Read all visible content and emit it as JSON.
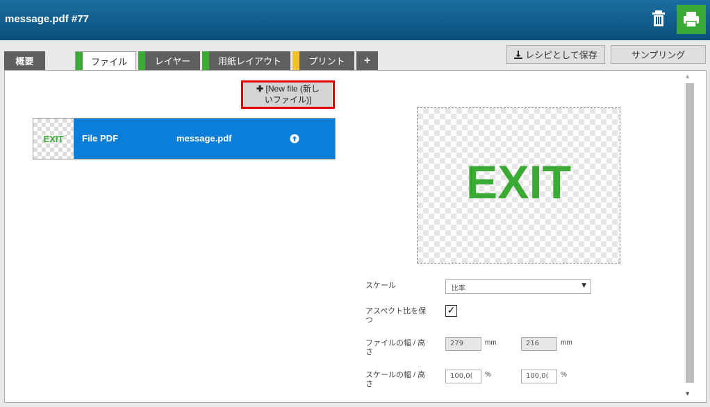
{
  "header": {
    "title": "message.pdf #77"
  },
  "tabs": [
    {
      "label": "概要",
      "stripe_color": ""
    },
    {
      "label": "ファイル",
      "stripe_color": "#3aaa35"
    },
    {
      "label": "レイヤー",
      "stripe_color": "#3aaa35"
    },
    {
      "label": "用紙レイアウト",
      "stripe_color": "#3aaa35"
    },
    {
      "label": "プリント",
      "stripe_color": "#f2c12e"
    },
    {
      "label": "+",
      "stripe_color": ""
    }
  ],
  "toolbar": {
    "save_recipe_label": "レシピとして保存",
    "sampling_label": "サンプリング"
  },
  "new_file": {
    "line1": "[New file (新し",
    "line2": "いファイル)]"
  },
  "file": {
    "thumb_text": "EXIT",
    "type": "File PDF",
    "name": "message.pdf"
  },
  "preview": {
    "text": "EXIT"
  },
  "form": {
    "scale_label": "スケール",
    "scale_value": "比率",
    "aspect_label": "アスペクト比を保つ",
    "aspect_checked": true,
    "file_size_label": "ファイルの幅 / 高さ",
    "file_width": "279",
    "file_height": "216",
    "file_unit": "mm",
    "scale_size_label": "スケールの幅 / 高さ",
    "scale_width": "100,0(",
    "scale_height": "100,0(",
    "scale_unit": "%"
  },
  "colors": {
    "header": "#0a4f7c",
    "accent_green": "#3aaa35",
    "file_row_blue": "#0a7ed9",
    "highlight_red": "#e00000"
  }
}
